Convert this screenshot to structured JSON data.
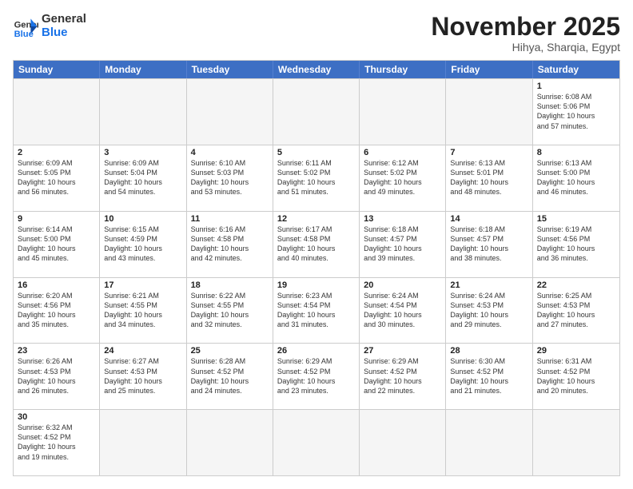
{
  "header": {
    "logo_general": "General",
    "logo_blue": "Blue",
    "month_title": "November 2025",
    "subtitle": "Hihya, Sharqia, Egypt"
  },
  "weekdays": [
    "Sunday",
    "Monday",
    "Tuesday",
    "Wednesday",
    "Thursday",
    "Friday",
    "Saturday"
  ],
  "rows": [
    [
      {
        "day": "",
        "info": ""
      },
      {
        "day": "",
        "info": ""
      },
      {
        "day": "",
        "info": ""
      },
      {
        "day": "",
        "info": ""
      },
      {
        "day": "",
        "info": ""
      },
      {
        "day": "",
        "info": ""
      },
      {
        "day": "1",
        "info": "Sunrise: 6:08 AM\nSunset: 5:06 PM\nDaylight: 10 hours\nand 57 minutes."
      }
    ],
    [
      {
        "day": "2",
        "info": "Sunrise: 6:09 AM\nSunset: 5:05 PM\nDaylight: 10 hours\nand 56 minutes."
      },
      {
        "day": "3",
        "info": "Sunrise: 6:09 AM\nSunset: 5:04 PM\nDaylight: 10 hours\nand 54 minutes."
      },
      {
        "day": "4",
        "info": "Sunrise: 6:10 AM\nSunset: 5:03 PM\nDaylight: 10 hours\nand 53 minutes."
      },
      {
        "day": "5",
        "info": "Sunrise: 6:11 AM\nSunset: 5:02 PM\nDaylight: 10 hours\nand 51 minutes."
      },
      {
        "day": "6",
        "info": "Sunrise: 6:12 AM\nSunset: 5:02 PM\nDaylight: 10 hours\nand 49 minutes."
      },
      {
        "day": "7",
        "info": "Sunrise: 6:13 AM\nSunset: 5:01 PM\nDaylight: 10 hours\nand 48 minutes."
      },
      {
        "day": "8",
        "info": "Sunrise: 6:13 AM\nSunset: 5:00 PM\nDaylight: 10 hours\nand 46 minutes."
      }
    ],
    [
      {
        "day": "9",
        "info": "Sunrise: 6:14 AM\nSunset: 5:00 PM\nDaylight: 10 hours\nand 45 minutes."
      },
      {
        "day": "10",
        "info": "Sunrise: 6:15 AM\nSunset: 4:59 PM\nDaylight: 10 hours\nand 43 minutes."
      },
      {
        "day": "11",
        "info": "Sunrise: 6:16 AM\nSunset: 4:58 PM\nDaylight: 10 hours\nand 42 minutes."
      },
      {
        "day": "12",
        "info": "Sunrise: 6:17 AM\nSunset: 4:58 PM\nDaylight: 10 hours\nand 40 minutes."
      },
      {
        "day": "13",
        "info": "Sunrise: 6:18 AM\nSunset: 4:57 PM\nDaylight: 10 hours\nand 39 minutes."
      },
      {
        "day": "14",
        "info": "Sunrise: 6:18 AM\nSunset: 4:57 PM\nDaylight: 10 hours\nand 38 minutes."
      },
      {
        "day": "15",
        "info": "Sunrise: 6:19 AM\nSunset: 4:56 PM\nDaylight: 10 hours\nand 36 minutes."
      }
    ],
    [
      {
        "day": "16",
        "info": "Sunrise: 6:20 AM\nSunset: 4:56 PM\nDaylight: 10 hours\nand 35 minutes."
      },
      {
        "day": "17",
        "info": "Sunrise: 6:21 AM\nSunset: 4:55 PM\nDaylight: 10 hours\nand 34 minutes."
      },
      {
        "day": "18",
        "info": "Sunrise: 6:22 AM\nSunset: 4:55 PM\nDaylight: 10 hours\nand 32 minutes."
      },
      {
        "day": "19",
        "info": "Sunrise: 6:23 AM\nSunset: 4:54 PM\nDaylight: 10 hours\nand 31 minutes."
      },
      {
        "day": "20",
        "info": "Sunrise: 6:24 AM\nSunset: 4:54 PM\nDaylight: 10 hours\nand 30 minutes."
      },
      {
        "day": "21",
        "info": "Sunrise: 6:24 AM\nSunset: 4:53 PM\nDaylight: 10 hours\nand 29 minutes."
      },
      {
        "day": "22",
        "info": "Sunrise: 6:25 AM\nSunset: 4:53 PM\nDaylight: 10 hours\nand 27 minutes."
      }
    ],
    [
      {
        "day": "23",
        "info": "Sunrise: 6:26 AM\nSunset: 4:53 PM\nDaylight: 10 hours\nand 26 minutes."
      },
      {
        "day": "24",
        "info": "Sunrise: 6:27 AM\nSunset: 4:53 PM\nDaylight: 10 hours\nand 25 minutes."
      },
      {
        "day": "25",
        "info": "Sunrise: 6:28 AM\nSunset: 4:52 PM\nDaylight: 10 hours\nand 24 minutes."
      },
      {
        "day": "26",
        "info": "Sunrise: 6:29 AM\nSunset: 4:52 PM\nDaylight: 10 hours\nand 23 minutes."
      },
      {
        "day": "27",
        "info": "Sunrise: 6:29 AM\nSunset: 4:52 PM\nDaylight: 10 hours\nand 22 minutes."
      },
      {
        "day": "28",
        "info": "Sunrise: 6:30 AM\nSunset: 4:52 PM\nDaylight: 10 hours\nand 21 minutes."
      },
      {
        "day": "29",
        "info": "Sunrise: 6:31 AM\nSunset: 4:52 PM\nDaylight: 10 hours\nand 20 minutes."
      }
    ],
    [
      {
        "day": "30",
        "info": "Sunrise: 6:32 AM\nSunset: 4:52 PM\nDaylight: 10 hours\nand 19 minutes."
      },
      {
        "day": "",
        "info": ""
      },
      {
        "day": "",
        "info": ""
      },
      {
        "day": "",
        "info": ""
      },
      {
        "day": "",
        "info": ""
      },
      {
        "day": "",
        "info": ""
      },
      {
        "day": "",
        "info": ""
      }
    ]
  ]
}
